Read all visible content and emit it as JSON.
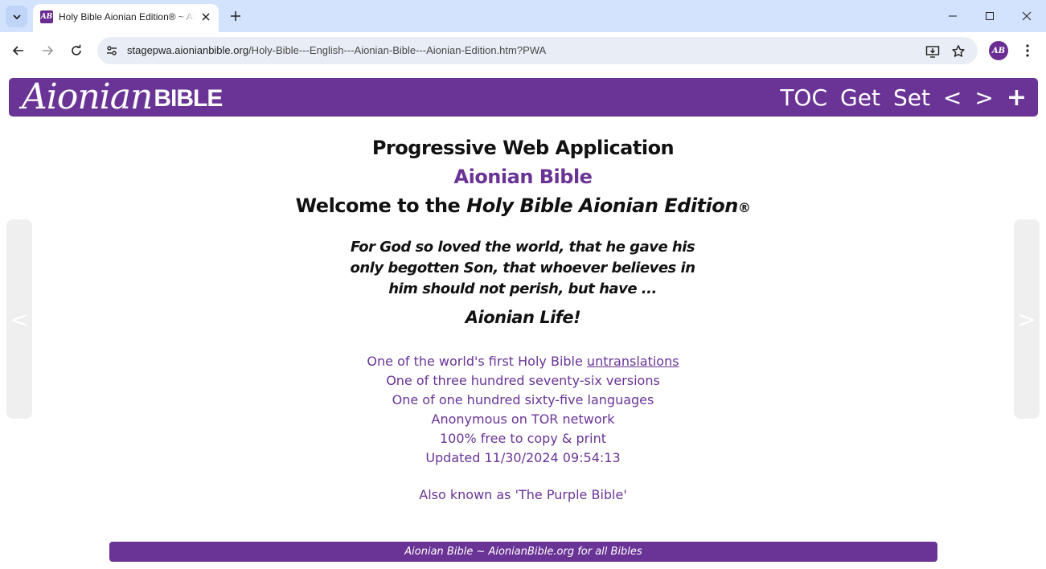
{
  "browser": {
    "tab_title": "Holy Bible Aionian Edition® ~ Aionian Bible",
    "favicon_text": "AB",
    "url_domain": "stagepwa.aionianbible.org",
    "url_path": "/Holy-Bible---English---Aionian-Bible---Aionian-Edition.htm?PWA",
    "profile_initials": "AB"
  },
  "header": {
    "logo_script": "Aionian",
    "logo_bold": "BIBLE",
    "nav": [
      "TOC",
      "Get",
      "Set",
      "<",
      ">",
      "+"
    ]
  },
  "side": {
    "prev": "<",
    "next": ">"
  },
  "main": {
    "heading1": "Progressive Web Application",
    "heading2": "Aionian Bible",
    "welcome_prefix": "Welcome to the ",
    "welcome_title": "Holy Bible Aionian Edition",
    "welcome_mark": "®",
    "verse": "For God so loved the world, that he gave his only begotten Son, that whoever believes in him should not perish, but have ...",
    "verse_end": "Aionian Life!",
    "fact1_prefix": "One of the world's first Holy Bible ",
    "fact1_link": "untranslations",
    "fact2": "One of three hundred seventy-six versions",
    "fact3": "One of one hundred sixty-five languages",
    "fact4": "Anonymous on TOR network",
    "fact5": "100% free to copy & print",
    "fact6": "Updated 11/30/2024 09:54:13",
    "aka": "Also known as 'The Purple Bible'"
  },
  "footer": {
    "text": "Aionian Bible ~ AionianBible.org for all Bibles"
  },
  "colors": {
    "brand_purple": "#6a3496",
    "chrome_blue": "#d3e3fd",
    "omnibox": "#e9eef6"
  }
}
